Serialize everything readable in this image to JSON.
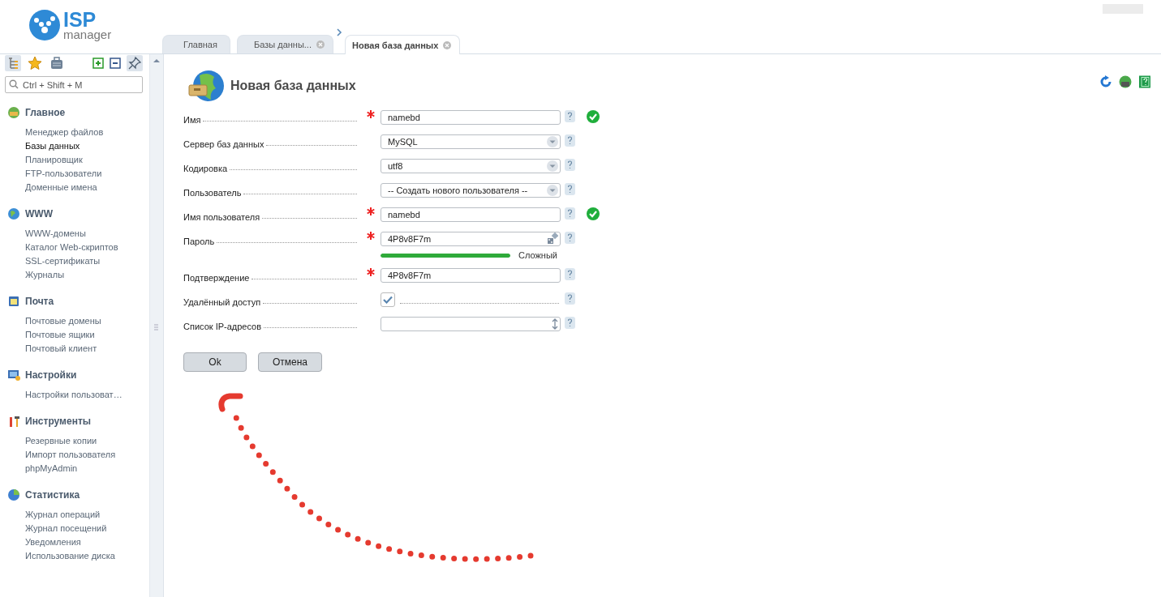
{
  "logo": {
    "brand": "ISP",
    "product": "manager"
  },
  "search": {
    "placeholder": "Ctrl + Shift + M"
  },
  "sidebar": {
    "groups": [
      {
        "title": "Главное",
        "items": [
          {
            "label": "Менеджер файлов",
            "selected": false
          },
          {
            "label": "Базы данных",
            "selected": true
          },
          {
            "label": "Планировщик",
            "selected": false
          },
          {
            "label": "FTP-пользователи",
            "selected": false
          },
          {
            "label": "Доменные имена",
            "selected": false
          }
        ]
      },
      {
        "title": "WWW",
        "items": [
          {
            "label": "WWW-домены",
            "selected": false
          },
          {
            "label": "Каталог Web-скриптов",
            "selected": false
          },
          {
            "label": "SSL-сертификаты",
            "selected": false
          },
          {
            "label": "Журналы",
            "selected": false
          }
        ]
      },
      {
        "title": "Почта",
        "items": [
          {
            "label": "Почтовые домены",
            "selected": false
          },
          {
            "label": "Почтовые ящики",
            "selected": false
          },
          {
            "label": "Почтовый клиент",
            "selected": false
          }
        ]
      },
      {
        "title": "Настройки",
        "items": [
          {
            "label": "Настройки пользоват…",
            "selected": false
          }
        ]
      },
      {
        "title": "Инструменты",
        "items": [
          {
            "label": "Резервные копии",
            "selected": false
          },
          {
            "label": "Импорт пользователя",
            "selected": false
          },
          {
            "label": "phpMyAdmin",
            "selected": false
          }
        ]
      },
      {
        "title": "Статистика",
        "items": [
          {
            "label": "Журнал операций",
            "selected": false
          },
          {
            "label": "Журнал посещений",
            "selected": false
          },
          {
            "label": "Уведомления",
            "selected": false
          },
          {
            "label": "Использование диска",
            "selected": false
          }
        ]
      }
    ]
  },
  "tabs": [
    {
      "label": "Главная",
      "selected": false,
      "closable": false
    },
    {
      "label": "Базы данны...",
      "selected": false,
      "closable": true
    },
    {
      "label": "Новая база данных",
      "selected": true,
      "closable": true
    }
  ],
  "form": {
    "title": "Новая база данных",
    "fields": [
      {
        "kind": "text",
        "label": "Имя",
        "required": true,
        "value": "namebd",
        "valid": true
      },
      {
        "kind": "select",
        "label": "Сервер баз данных",
        "required": false,
        "value": "MySQL",
        "valid": false
      },
      {
        "kind": "select",
        "label": "Кодировка",
        "required": false,
        "value": "utf8",
        "valid": false
      },
      {
        "kind": "select",
        "label": "Пользователь",
        "required": false,
        "value": "-- Создать нового пользователя --",
        "valid": false
      },
      {
        "kind": "text",
        "label": "Имя пользователя",
        "required": true,
        "value": "namebd",
        "valid": true
      },
      {
        "kind": "password",
        "label": "Пароль",
        "required": true,
        "value": "4P8v8F7m",
        "valid": false,
        "level": 1,
        "strength": "Сложный"
      },
      {
        "kind": "text",
        "label": "Подтверждение",
        "required": true,
        "value": "4P8v8F7m",
        "valid": false
      },
      {
        "kind": "checkbox",
        "label": "Удалённый доступ",
        "required": false,
        "checked": true,
        "valid": false
      },
      {
        "kind": "list",
        "label": "Список IP-адресов",
        "required": false,
        "valid": false
      }
    ],
    "buttons": [
      {
        "label": "Ok",
        "kind": "primary"
      },
      {
        "label": "Отмена",
        "kind": "cancel"
      }
    ]
  }
}
